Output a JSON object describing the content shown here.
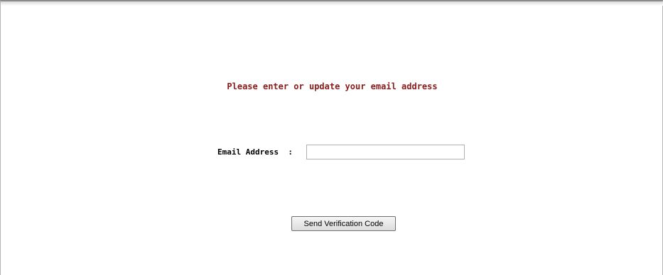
{
  "form": {
    "heading": "Please enter or update your email address",
    "email_label": "Email Address  :",
    "email_value": "",
    "email_placeholder": "",
    "send_button_label": "Send Verification Code"
  }
}
